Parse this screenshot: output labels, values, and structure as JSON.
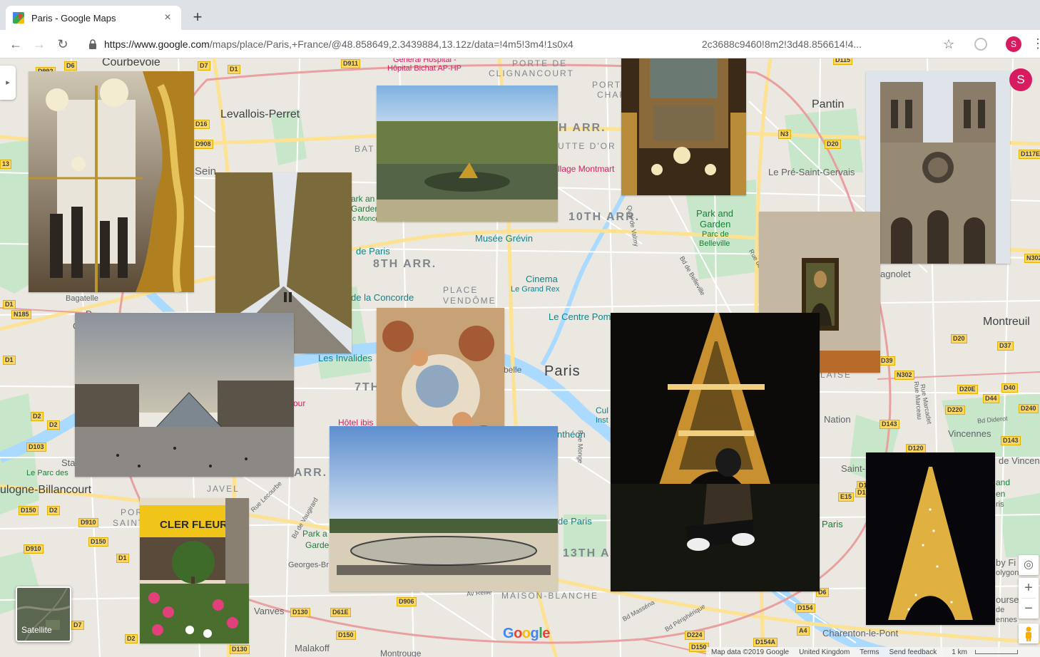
{
  "browser": {
    "tab_title": "Paris - Google Maps",
    "close_glyph": "×",
    "new_tab_glyph": "+",
    "url_host": "https://www.google.com",
    "url_path_before": "/maps/place/Paris,+France/@48.858649,2.3439884,13.12z/data=!4m5!3m4!1s0x4",
    "url_path_after": "2c3688c9460!8m2!3d48.856614!4...",
    "profile_initial": "S",
    "back_glyph": "←",
    "forward_glyph": "→",
    "reload_glyph": "↻",
    "star_glyph": "☆",
    "menu_glyph": "⋮"
  },
  "map": {
    "side_toggle_glyph": "▸",
    "account_initial": "S",
    "zoom_in": "+",
    "zoom_out": "−",
    "locate_glyph": "◎",
    "satellite_label": "Satellite",
    "logo": [
      "G",
      "o",
      "o",
      "g",
      "l",
      "e"
    ],
    "logo_colors": [
      "#4285f4",
      "#ea4335",
      "#fbbc05",
      "#4285f4",
      "#34a853",
      "#ea4335"
    ],
    "footer": {
      "map_data": "Map data ©2019 Google",
      "region": "United Kingdom",
      "terms": "Terms",
      "feedback": "Send feedback",
      "scale": "1 km"
    },
    "labels": {
      "courbevoie": "Courbevoie",
      "levallois": "Levallois-Perret",
      "pantin": "Pantin",
      "pre_saint_gervais": "Le Pré-Saint-Gervais",
      "montreuil": "Montreuil",
      "vincennes": "Vincennes",
      "charenton": "Charenton-le-Pont",
      "malakoff": "Malakoff",
      "vanves": "Vanves",
      "boulogne": "ulogne-Billancourt",
      "bagatelle": "Bagatelle",
      "paris": "Paris",
      "arr_8": "8TH ARR.",
      "arr_10": "10TH ARR.",
      "arr_10_partial": "H ARR.",
      "arr_7": "7TH",
      "arr_13": "13TH A",
      "arr_15": "ARR.",
      "place_vendome_1": "PLACE",
      "place_vendome_2": "VENDÔME",
      "maison_blanche": "MAISON-BLANCHE",
      "javel": "JAVEL",
      "porte_clignancourt_1": "PORTE DE",
      "porte_clignancourt_2": "CLIGNANCOURT",
      "porte_chap": "PORTE",
      "porte_chap_2": "CHAP",
      "butte": "UTTE D'OR",
      "bat": "BAT",
      "musee_grevin": "Musée Grévin",
      "cinema": "Cinema",
      "grand_rex": "Le Grand Rex",
      "centre_pom": "Le Centre Pom",
      "concorde": "de la Concorde",
      "invalides": "Les Invalides",
      "hotel_ibis": "Hôtel ibis",
      "pantheon": "nthéon",
      "montmartre": "llage Montmart",
      "park_belleville_1": "Park and",
      "park_belleville_2": "Garden",
      "parc_belleville_1": "Parc de",
      "parc_belleville_2": "Belleville",
      "bichat_1": "Général Hospital -",
      "bichat_2": "Hôpital Bichat AP-HP",
      "nation": "Nation",
      "saint_m": "Saint-",
      "de_vincen": "de Vincen",
      "de_paris": "de Paris",
      "de_paris_south": "de Paris",
      "paris_small": "Paris",
      "park_georges_1": "Park a",
      "park_georges_2": "Garde",
      "park_georges_3": "Georges-Br",
      "le_parc_des": "Le Parc des",
      "seine": "Sein",
      "magnolet": "agnolet",
      "laise": "LAISE",
      "ark_an": "ark an",
      "garden_m": "Garden",
      "monceau": "c Monceau",
      "a_de_paris": "de Paris",
      "belle": "belle",
      "and_right_1": "and",
      "and_right_2": "en",
      "and_right_3": "ris",
      "byfi": "by Fi",
      "olygon": "olygon",
      "ourse": "ourse",
      "de_right": "de",
      "enne": "ennes",
      "cul": "Cul",
      "inst": "Inst",
      "montrouge": "Montrouge",
      "our": "our",
      "sta": "Sta",
      "p_left": "P",
      "g_left": "G",
      "port": "POR",
      "saint_left": "SAINT"
    },
    "shields": [
      "D992",
      "D6",
      "D7",
      "D1",
      "D911",
      "D16",
      "D908",
      "D115",
      "N3",
      "D20",
      "D117E",
      "N302",
      "D20",
      "D37",
      "D39",
      "N302",
      "D20E",
      "D44",
      "D40",
      "D220",
      "D240",
      "D143",
      "D143",
      "D120",
      "E15",
      "D1",
      "N185",
      "D1",
      "D2",
      "D103",
      "D150",
      "D2",
      "D910",
      "D150",
      "D910",
      "D1",
      "D7",
      "D2",
      "D130",
      "D130",
      "D61E",
      "D150",
      "D906",
      "D224",
      "D150",
      "D154",
      "D154A",
      "A4",
      "D6",
      "D1",
      "13",
      "D1",
      "D2"
    ],
    "streets": [
      "Quai de Valmy",
      "Bd de Belleville",
      "Rue Marcadet",
      "Bd Masséna",
      "Bd Périphérique",
      "Av Reille",
      "Rue Monge",
      "Bd de Vaugirard",
      "Rue Lecourbe",
      "Rue des Pyr",
      "Rue Marceau",
      "Bd Diderot"
    ]
  },
  "photos": [
    {
      "name": "versailles-mirror-chandelier-photo"
    },
    {
      "name": "versailles-tree-avenue-photo"
    },
    {
      "name": "versailles-fountain-garden-photo"
    },
    {
      "name": "hall-of-mirrors-ceiling-photo"
    },
    {
      "name": "notre-dame-facade-photo"
    },
    {
      "name": "mona-lisa-photo"
    },
    {
      "name": "louvre-pyramid-photo"
    },
    {
      "name": "painted-ceiling-photo"
    },
    {
      "name": "versailles-gardens-crowd-photo"
    },
    {
      "name": "eiffel-tower-night-person-photo"
    },
    {
      "name": "eiffel-tower-sparkle-photo"
    },
    {
      "name": "cler-fleurs-shop-photo"
    }
  ],
  "signage": {
    "cler_fleurs": "CLER FLEURS"
  }
}
